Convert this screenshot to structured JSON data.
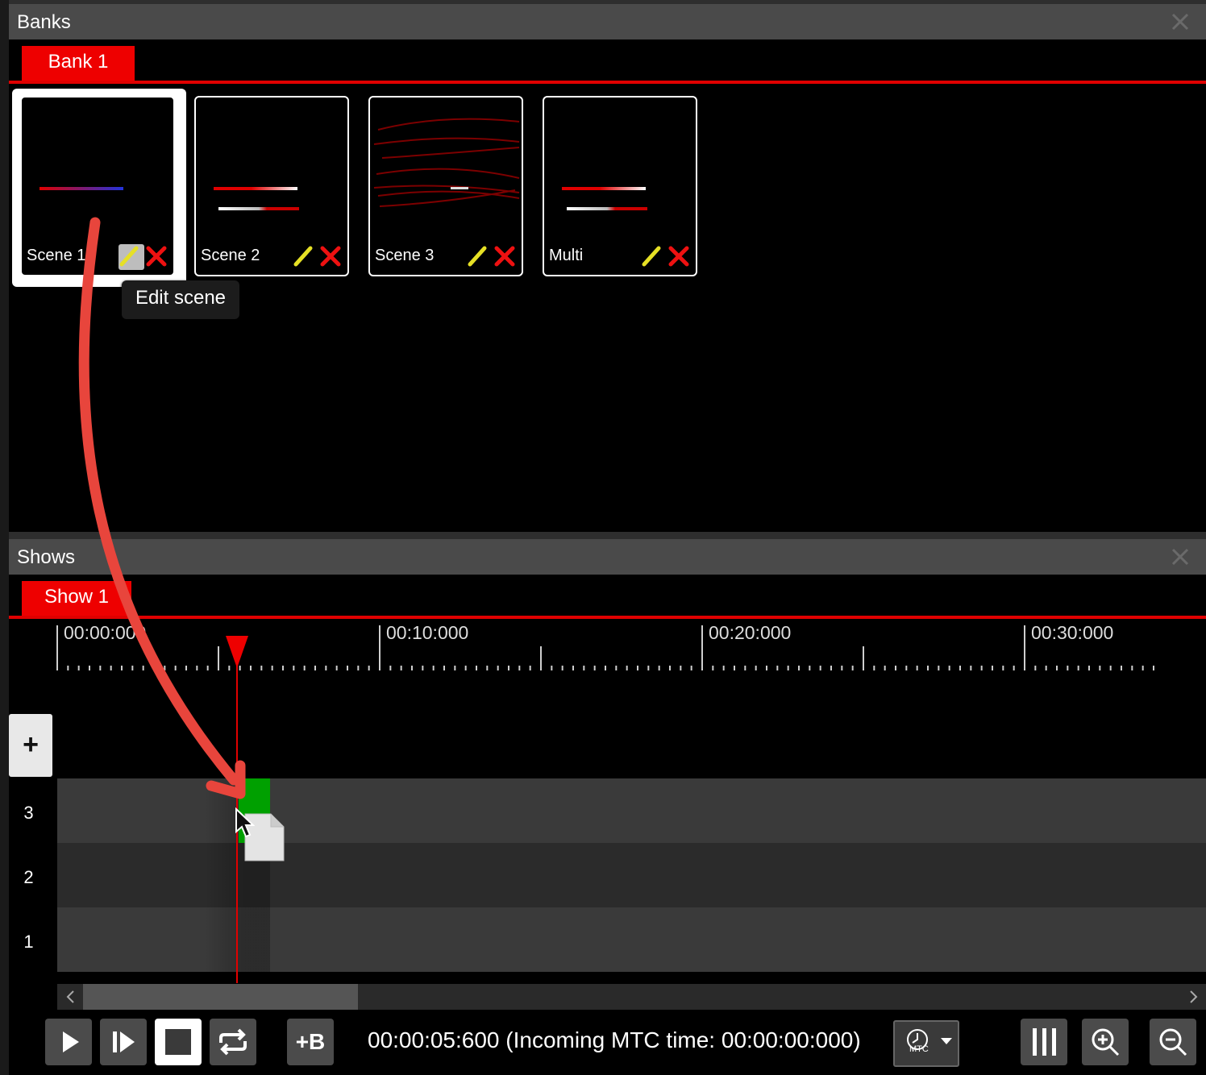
{
  "banks": {
    "title": "Banks",
    "tab": "Bank 1",
    "scenes": [
      {
        "name": "Scene 1",
        "edit_icon": "pencil-icon",
        "delete_icon": "x-icon"
      },
      {
        "name": "Scene 2",
        "edit_icon": "pencil-icon",
        "delete_icon": "x-icon"
      },
      {
        "name": "Scene 3",
        "edit_icon": "pencil-icon",
        "delete_icon": "x-icon"
      },
      {
        "name": "Multi",
        "edit_icon": "pencil-icon",
        "delete_icon": "x-icon"
      }
    ],
    "tooltip": "Edit scene"
  },
  "shows": {
    "title": "Shows",
    "tab": "Show 1",
    "timeline": {
      "labels": [
        "00:00:000",
        "00:10:000",
        "00:20:000",
        "00:30:000"
      ]
    },
    "add_track_label": "+",
    "tracks": [
      "3",
      "2",
      "1"
    ],
    "playhead_time": "00:00:05:600",
    "time_readout": "00:00:05:600 (Incoming MTC time: 00:00:00:000)",
    "mtc_label": "MTC",
    "controls": [
      "play-icon",
      "step-play-icon",
      "stop-icon",
      "loop-icon",
      "add-bank-icon",
      "mtc-clock-icon",
      "columns-icon",
      "zoom-in-icon",
      "zoom-out-icon"
    ],
    "blackout_label": "+B"
  },
  "colors": {
    "accent_red": "#ee0000",
    "clip_green": "#00a000",
    "panel_header": "#4a4a4a",
    "background": "#000000"
  }
}
